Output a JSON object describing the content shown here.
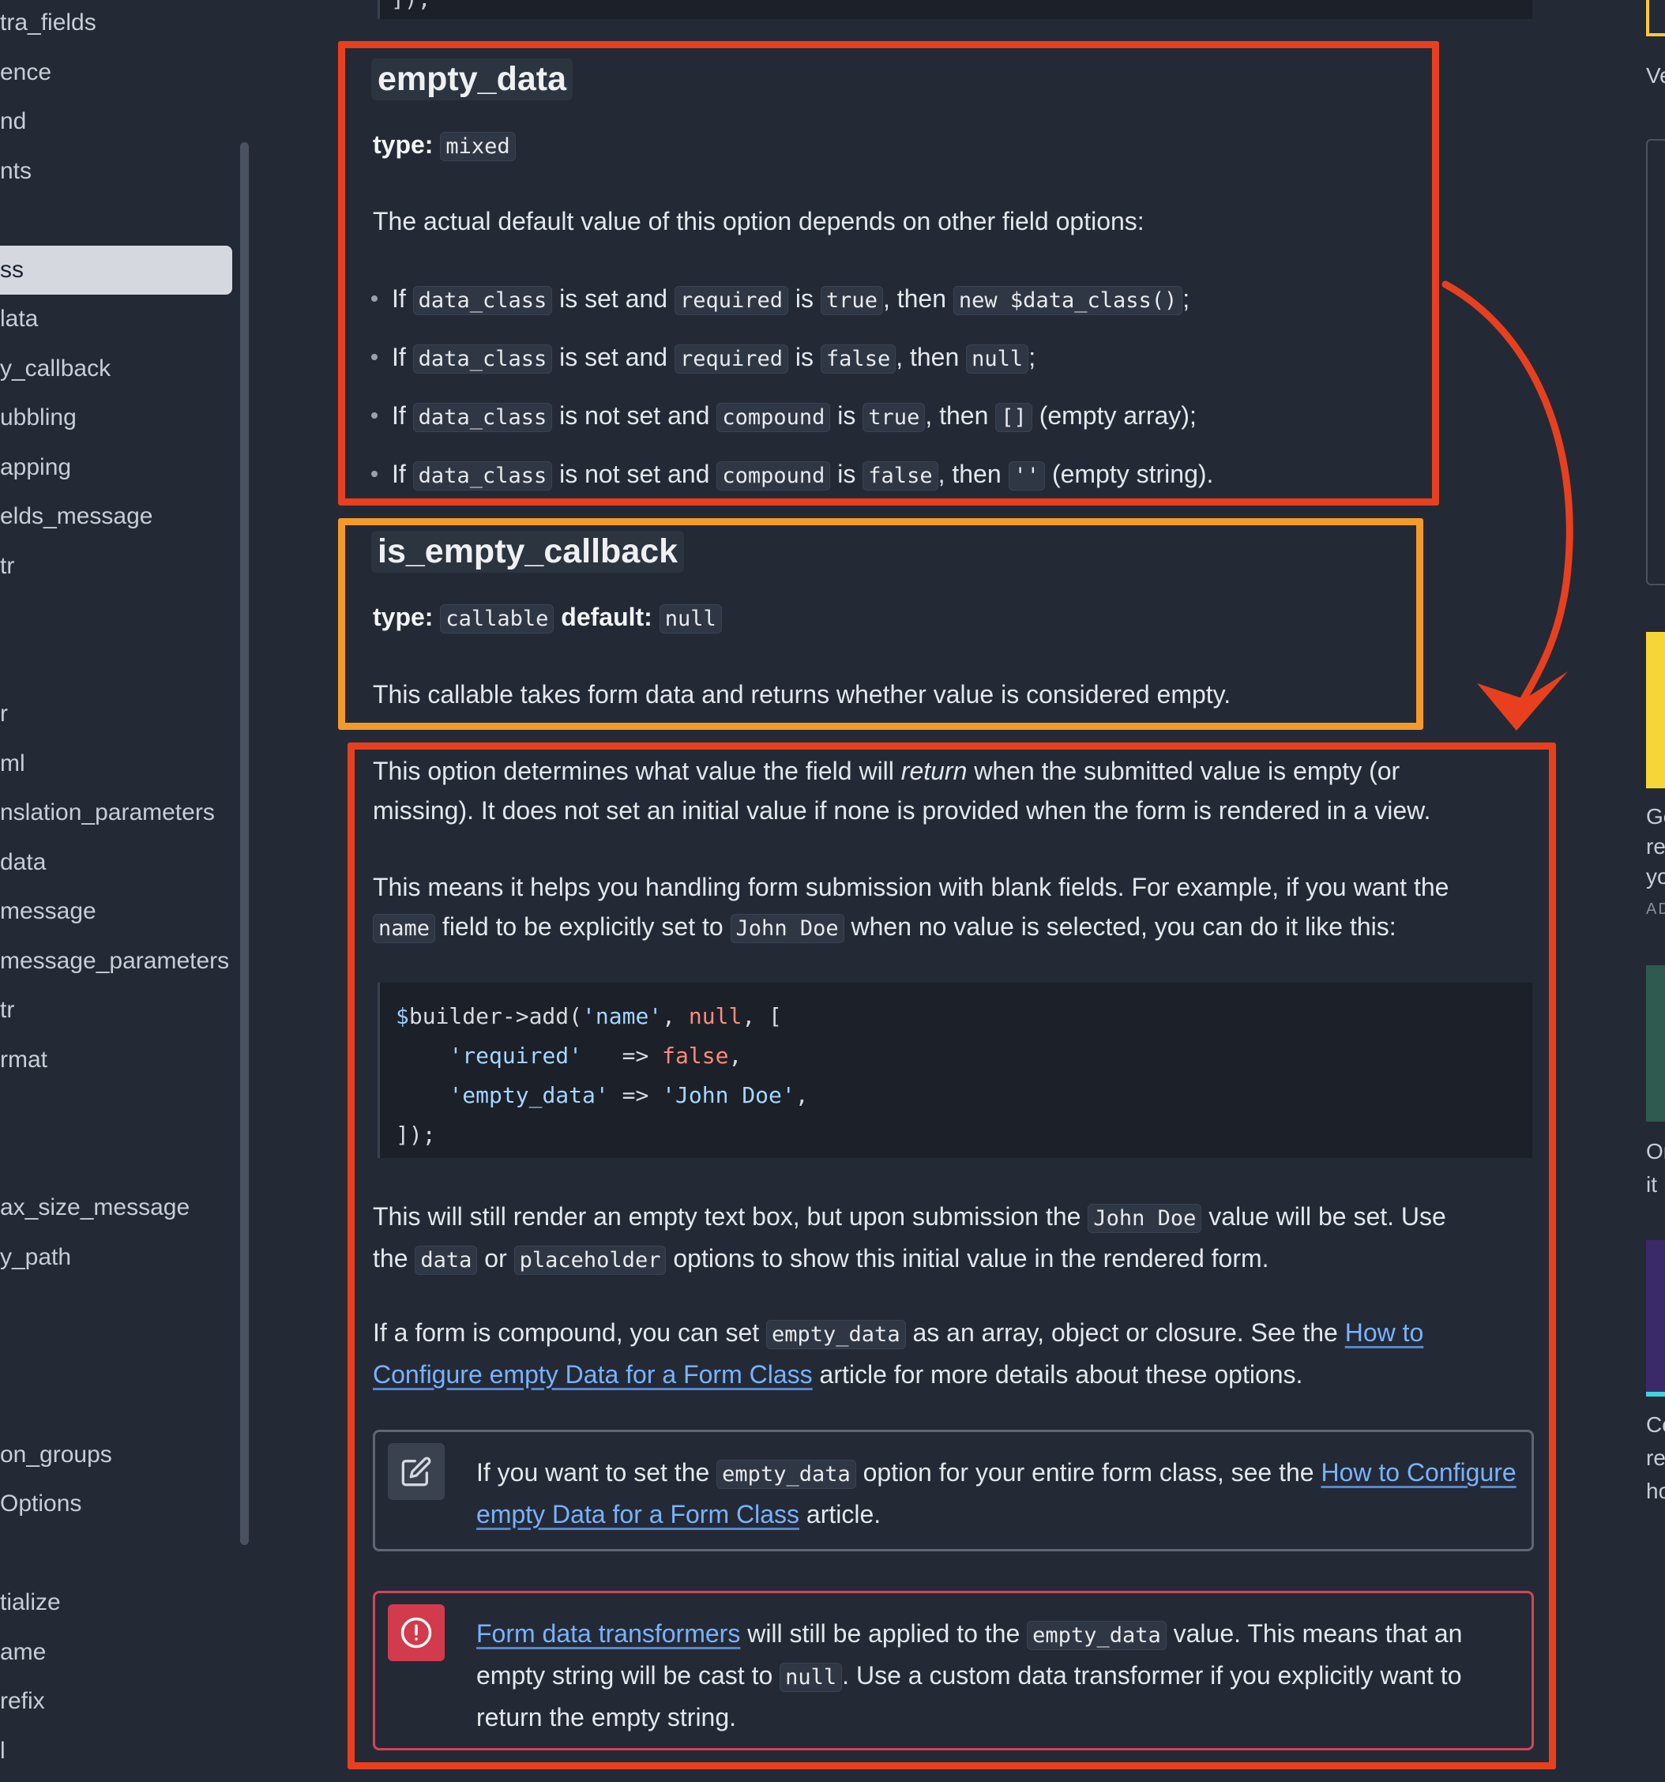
{
  "sidebar": {
    "items": [
      {
        "label": "tra_fields",
        "active": false
      },
      {
        "label": "ence",
        "active": false
      },
      {
        "label": "nd",
        "active": false
      },
      {
        "label": "nts",
        "active": false
      },
      {
        "label": "ss",
        "active": true
      },
      {
        "label": "lata",
        "active": false
      },
      {
        "label": "y_callback",
        "active": false
      },
      {
        "label": "ubbling",
        "active": false
      },
      {
        "label": "apping",
        "active": false
      },
      {
        "label": "elds_message",
        "active": false
      },
      {
        "label": "tr",
        "active": false
      },
      {
        "label": "r",
        "active": false
      },
      {
        "label": "ml",
        "active": false
      },
      {
        "label": "nslation_parameters",
        "active": false
      },
      {
        "label": "data",
        "active": false
      },
      {
        "label": "message",
        "active": false
      },
      {
        "label": "message_parameters",
        "active": false
      },
      {
        "label": "tr",
        "active": false
      },
      {
        "label": "rmat",
        "active": false
      },
      {
        "label": "ax_size_message",
        "active": false
      },
      {
        "label": "y_path",
        "active": false
      },
      {
        "label": "on_groups",
        "active": false
      },
      {
        "label": "Options",
        "active": false
      },
      {
        "label": "tialize",
        "active": false
      },
      {
        "label": "ame",
        "active": false
      },
      {
        "label": "refix",
        "active": false
      },
      {
        "label": "l",
        "active": false
      }
    ]
  },
  "top_code_tail": "]);",
  "empty_data": {
    "title": "empty_data",
    "type_label": "type:",
    "type_value": "mixed",
    "intro": "The actual default value of this option depends on other field options:",
    "bullets": [
      [
        "If ",
        "data_class",
        " is set and ",
        "required",
        " is ",
        "true",
        ", then ",
        "new $data_class()",
        ";"
      ],
      [
        "If ",
        "data_class",
        " is set and ",
        "required",
        " is ",
        "false",
        ", then ",
        "null",
        ";"
      ],
      [
        "If ",
        "data_class",
        " is not set and ",
        "compound",
        " is ",
        "true",
        ", then ",
        "[]",
        " (empty array);"
      ],
      [
        "If ",
        "data_class",
        " is not set and ",
        "compound",
        " is ",
        "false",
        ", then ",
        "''",
        " (empty string)."
      ]
    ]
  },
  "is_empty_callback": {
    "title": "is_empty_callback",
    "type_label": "type:",
    "type_value": "callable",
    "default_label": "default:",
    "default_value": "null",
    "description": "This callable takes form data and returns whether value is considered empty."
  },
  "description": {
    "p1_a": "This option determines what value the field will ",
    "p1_em": "return",
    "p1_b": " when the submitted value is empty (or missing). It does not set an initial value if none is provided when the form is rendered in a view.",
    "p2_a": "This means it helps you handling form submission with blank fields. For example, if you want the ",
    "p2_code1": "name",
    "p2_b": " field to be explicitly set to ",
    "p2_code2": "John Doe",
    "p2_c": " when no value is selected, you can do it like this:",
    "code_lines": [
      "$builder->add('name', null, [",
      "    'required'   => false,",
      "    'empty_data' => 'John Doe',",
      "]);"
    ],
    "p3_a": "This will still render an empty text box, but upon submission the ",
    "p3_code1": "John Doe",
    "p3_b": " value will be set. Use the ",
    "p3_code2": "data",
    "p3_c": " or ",
    "p3_code3": "placeholder",
    "p3_d": " options to show this initial value in the rendered form.",
    "p4_a": "If a form is compound, you can set ",
    "p4_code": "empty_data",
    "p4_b": " as an array, object or closure. See the ",
    "p4_link": "How to Configure empty Data for a Form Class",
    "p4_c": " article for more details about these options."
  },
  "note": {
    "icon": "edit-icon",
    "a": "If you want to set the ",
    "code": "empty_data",
    "b": " option for your entire form class, see the ",
    "link": "How to Configure empty Data for a Form Class",
    "c": " article."
  },
  "caution": {
    "icon": "alert-circle-icon",
    "link": "Form data transformers",
    "a": " will still be applied to the ",
    "code1": "empty_data",
    "b": " value. This means that an empty string will be cast to ",
    "code2": "null",
    "c": ". Use a custom data transformer if you explicitly want to return the empty string."
  },
  "right_rail": {
    "items": [
      "Ve",
      "Ge",
      "re",
      "yo",
      "AD",
      "Or",
      "it",
      "Co",
      "re",
      "ho"
    ]
  },
  "colors": {
    "annotation_red": "#e8401f",
    "annotation_orange": "#f39a2a",
    "link": "#7ab2ff",
    "caution": "#d23b4c"
  }
}
